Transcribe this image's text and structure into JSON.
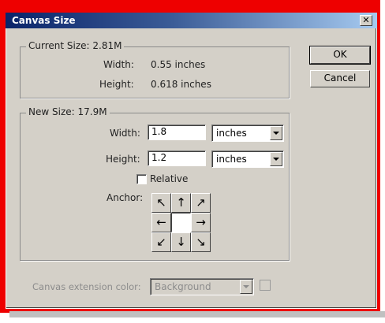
{
  "window": {
    "title": "Canvas Size"
  },
  "current_size": {
    "label": "Current Size: 2.81M",
    "width_label": "Width:",
    "width_value": "0.55 inches",
    "height_label": "Height:",
    "height_value": "0.618 inches"
  },
  "new_size": {
    "label": "New Size: 17.9M",
    "width_label": "Width:",
    "width_value": "1.8",
    "width_unit": "inches",
    "height_label": "Height:",
    "height_value": "1.2",
    "height_unit": "inches",
    "relative_label": "Relative",
    "relative_checked": false,
    "anchor_label": "Anchor:",
    "anchor_arrows": [
      "↖",
      "↑",
      "↗",
      "←",
      "",
      "→",
      "↙",
      "↓",
      "↘"
    ]
  },
  "buttons": {
    "ok": "OK",
    "cancel": "Cancel"
  },
  "extension": {
    "label": "Canvas extension color:",
    "value": "Background"
  },
  "colors": {
    "frame": "#ee0000",
    "dialog_bg": "#d4d0c8",
    "title_bar": "#0a246a"
  }
}
